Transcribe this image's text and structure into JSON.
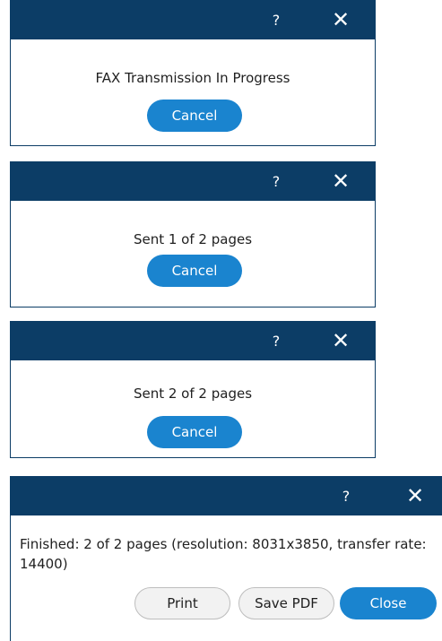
{
  "colors": {
    "titlebar": "#0c3d66",
    "primary_button": "#1a84cf",
    "secondary_button": "#f2f2f2"
  },
  "icons": {
    "help": "question-mark",
    "close": "x-mark"
  },
  "titlebar_glyphs": {
    "help": "?",
    "close": "✕"
  },
  "dialogs": [
    {
      "message": "FAX Transmission In Progress",
      "cancel_label": "Cancel"
    },
    {
      "message": "Sent 1 of 2 pages",
      "cancel_label": "Cancel"
    },
    {
      "message": "Sent 2 of 2 pages",
      "cancel_label": "Cancel"
    },
    {
      "message": "Finished: 2 of 2 pages (resolution: 8031x3850, transfer rate: 14400)",
      "print_label": "Print",
      "save_pdf_label": "Save PDF",
      "close_label": "Close"
    }
  ]
}
